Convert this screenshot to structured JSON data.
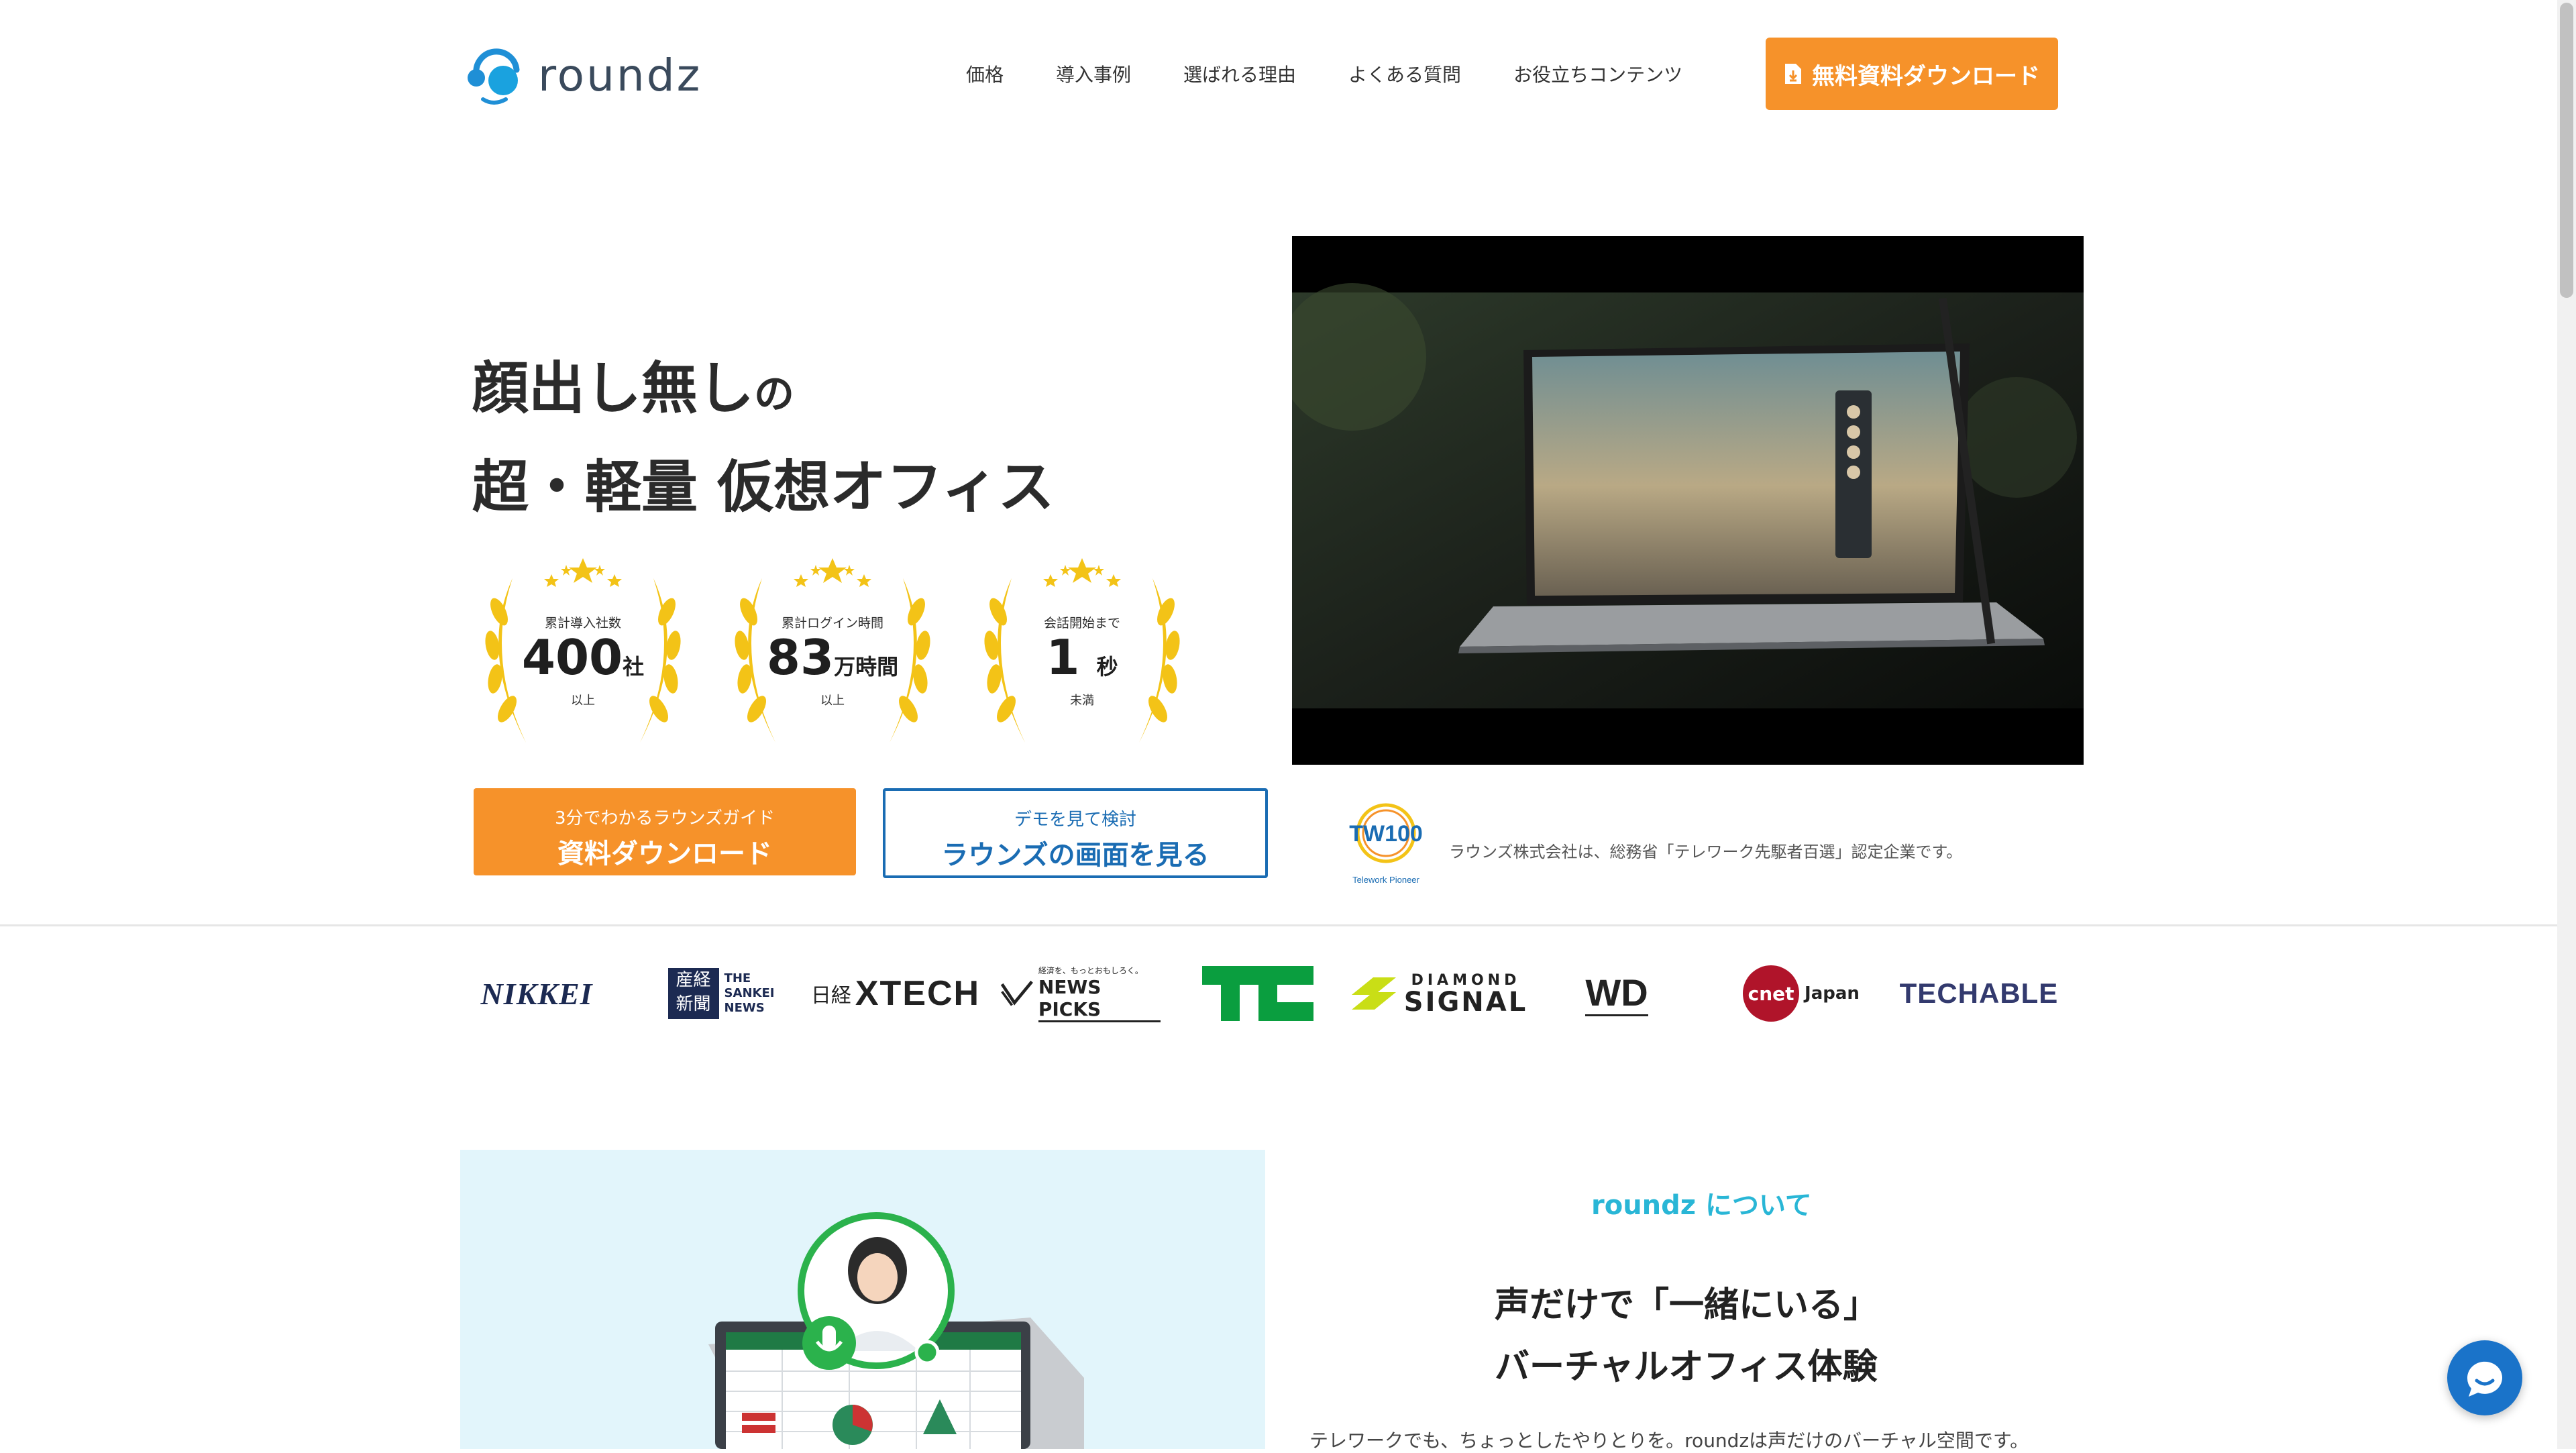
{
  "header": {
    "logo_text": "roundz",
    "nav": [
      "価格",
      "導入事例",
      "選ばれる理由",
      "よくある質問",
      "お役立ちコンテンツ"
    ],
    "download_label": "無料資料ダウンロード"
  },
  "hero": {
    "headline_line1_main": "顔出し無し",
    "headline_line1_small": "の",
    "headline_line2": "超・軽量 仮想オフィス",
    "awards": [
      {
        "caption": "累計導入社数",
        "value": "400",
        "unit": "社",
        "sub": "以上"
      },
      {
        "caption": "累計ログイン時間",
        "value": "83",
        "unit": "万時間",
        "sub": "以上"
      },
      {
        "caption": "会話開始まで",
        "value": "1",
        "unit": "秒",
        "sub": "未満"
      }
    ],
    "cta_primary_small": "3分でわかるラウンズガイド",
    "cta_primary_big": "資料ダウンロード",
    "cta_secondary_small": "デモを見て検討",
    "cta_secondary_big": "ラウンズの画面を見る",
    "telework_logo_text": "TW100",
    "telework_logo_sub": "Telework Pioneer",
    "telework_text": "ラウンズ株式会社は、総務省「テレワーク先駆者百選」認定企業です。"
  },
  "media": {
    "nikkei": "NIKKEI",
    "sankei_kanji": "産経新聞",
    "sankei_en_1": "THE",
    "sankei_en_2": "SANKEI",
    "sankei_en_3": "NEWS",
    "xtech_prefix": "日経",
    "xtech": "XTECH",
    "newspicks_tag": "経済を、もっとおもしろく。",
    "newspicks": "NEWS PICKS",
    "techcrunch": "TC",
    "diamond_1": "DIAMOND",
    "diamond_2": "SIGNAL",
    "wd": "WD",
    "cnet": "cnet",
    "cnet_japan": "Japan",
    "techable": "TECHABLE"
  },
  "about": {
    "heading": "roundz について",
    "title_line1": "声だけで「一緒にいる」",
    "title_line2": "バーチャルオフィス体験",
    "paragraph": "テレワークでも、ちょっとしたやりとりを。roundzは声だけのバーチャル空間です。"
  },
  "colors": {
    "accent_orange": "#f6922a",
    "accent_blue": "#1a6cb3",
    "about_cyan": "#29b6d6",
    "chat_blue": "#1a73c9"
  }
}
